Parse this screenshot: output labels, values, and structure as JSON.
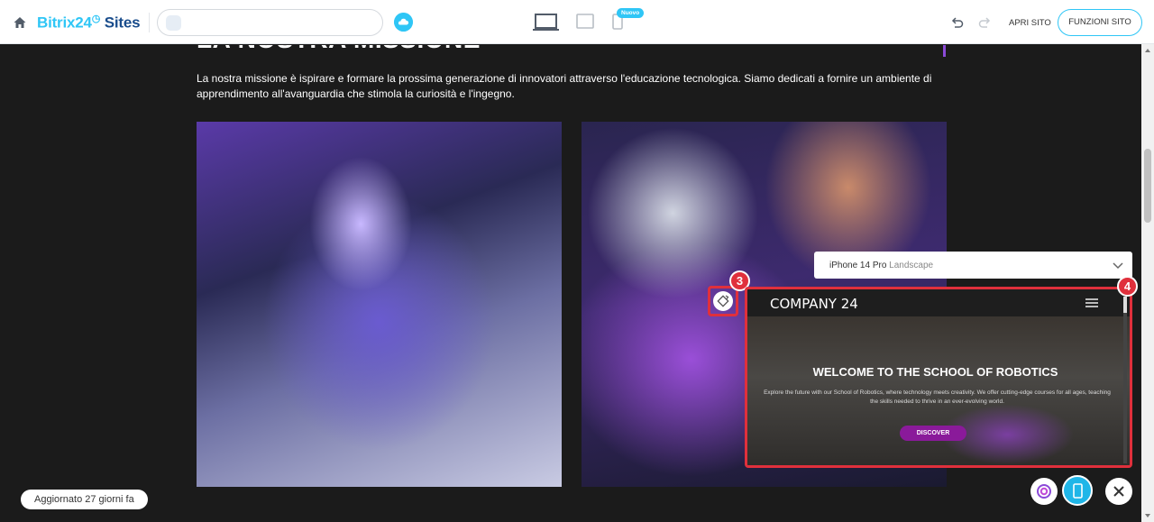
{
  "toolbar": {
    "logo_part1": "Bitrix24",
    "logo_clock": "◷",
    "logo_part2": "Sites",
    "badge_new": "Nuovo",
    "open_site": "APRI SITO",
    "site_functions": "FUNZIONI SITO"
  },
  "page": {
    "heading": "LA NOSTRA MISSIONE",
    "paragraph": "La nostra missione è ispirare e formare la prossima generazione di innovatori attraverso l'educazione tecnologica. Siamo dedicati a fornire un ambiente di apprendimento all'avanguardia che stimola la curiosità e l'ingegno."
  },
  "device_preview": {
    "device_name": "iPhone 14 Pro",
    "orientation": "Landscape",
    "site_brand": "COMPANY 24",
    "hero_title": "WELCOME TO THE SCHOOL OF ROBOTICS",
    "hero_text": "Explore the future with our School of Robotics, where technology meets creativity. We offer cutting-edge courses for all ages, teaching the skills needed to thrive in an ever-evolving world.",
    "hero_button": "DISCOVER"
  },
  "callouts": {
    "rotate": "3",
    "preview": "4"
  },
  "status": {
    "updated": "Aggiornato 27 giorni fa"
  },
  "colors": {
    "accent": "#2fc6f6",
    "callout": "#e0303c",
    "brand_dark": "#1a4d8c",
    "purple": "#8b4ad8"
  }
}
